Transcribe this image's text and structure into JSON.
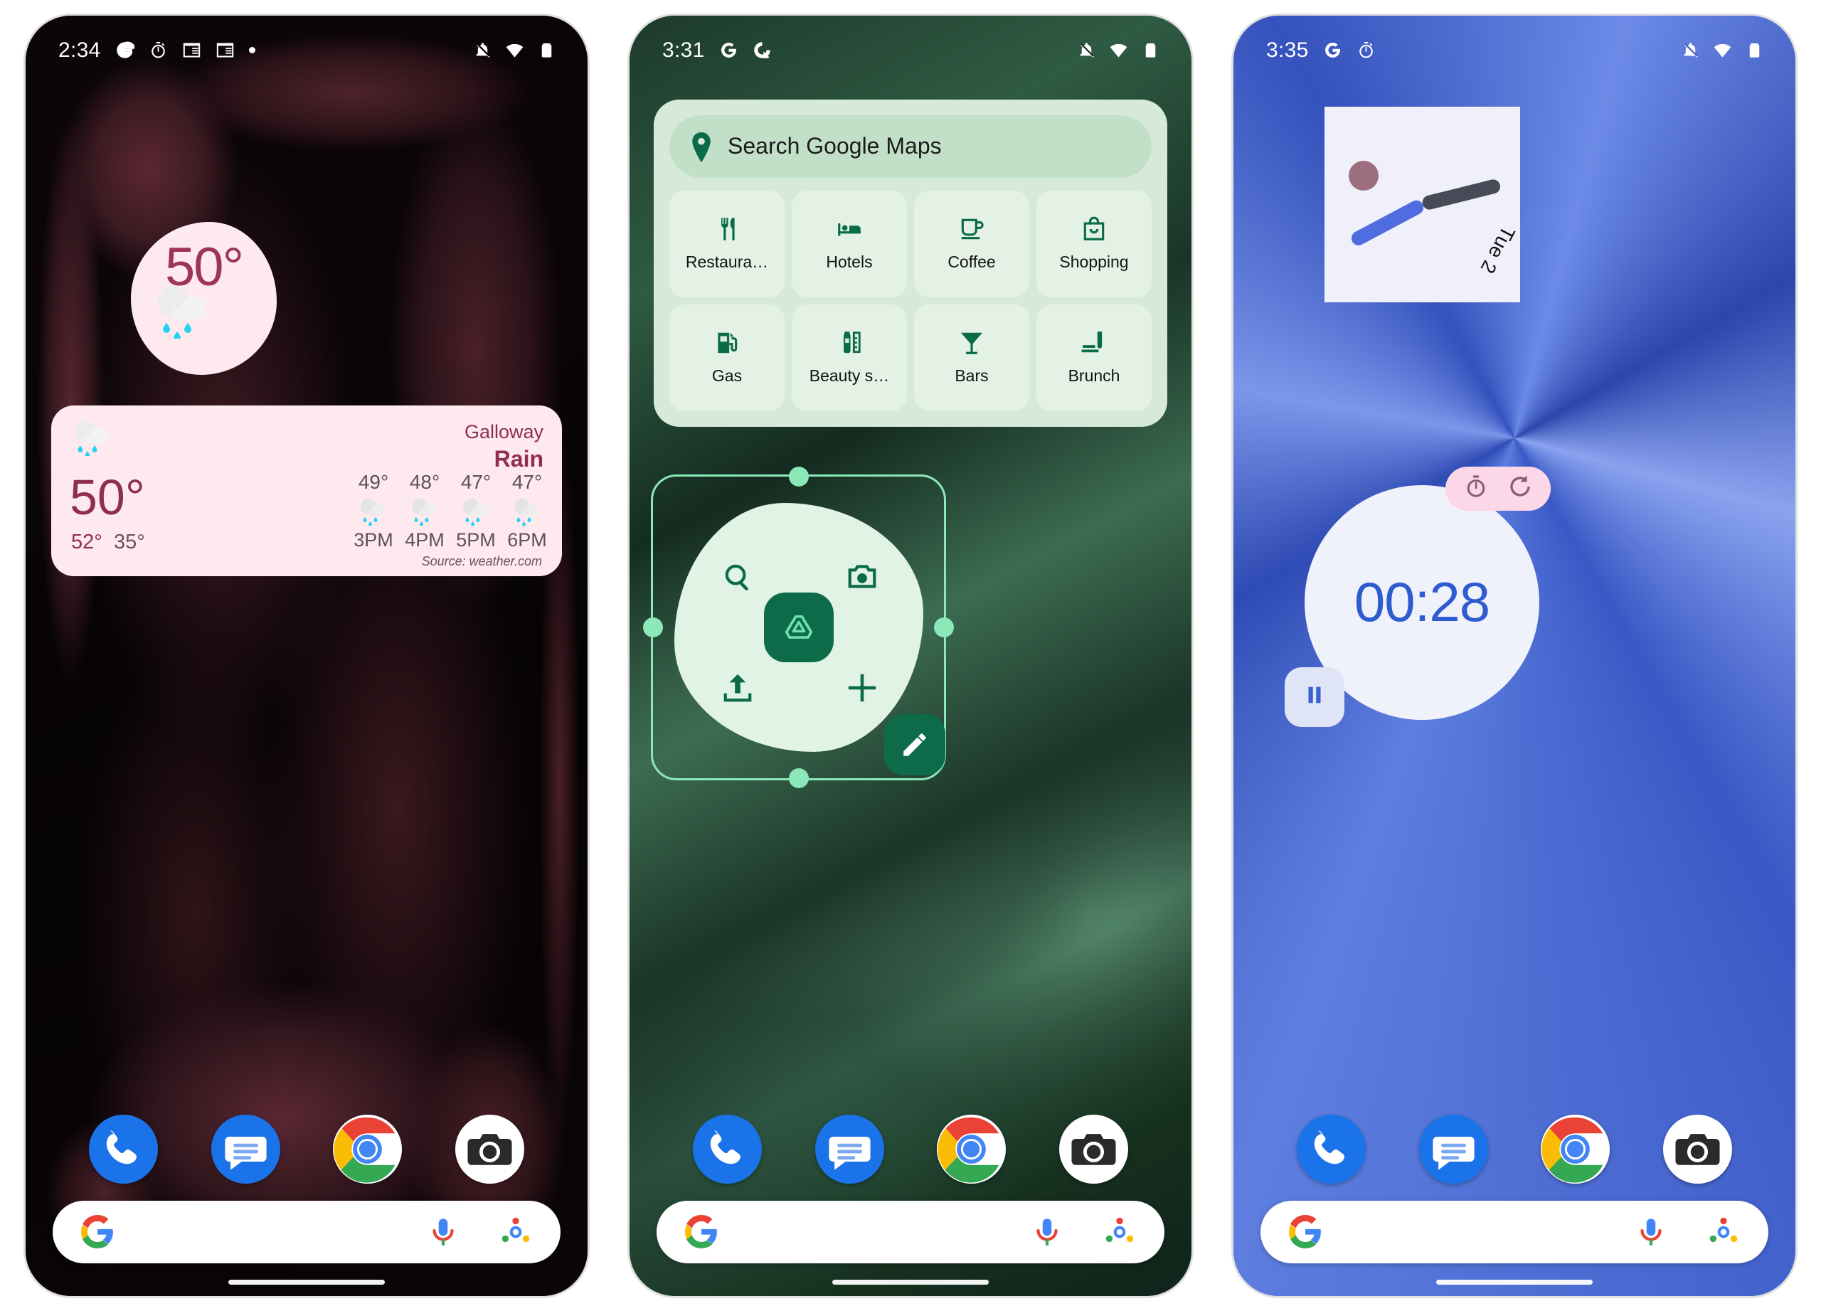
{
  "phones": [
    {
      "id": "phone-weather",
      "status": {
        "time": "2:34",
        "icons": [
          "google-g-icon",
          "timer-icon",
          "calendar-icon",
          "calendar-icon",
          "dot-icon"
        ],
        "right_icons": [
          "notifications-off-icon",
          "wifi-icon",
          "battery-icon"
        ]
      },
      "weather_bubble": {
        "temperature": "50°",
        "icon": "rain-cloud-icon"
      },
      "weather_card": {
        "location": "Galloway",
        "condition": "Rain",
        "temperature": "50°",
        "high": "52°",
        "low": "35°",
        "source": "Source: weather.com",
        "hourly": [
          {
            "temp": "49°",
            "label": "3PM",
            "icon": "rain-cloud-icon"
          },
          {
            "temp": "48°",
            "label": "4PM",
            "icon": "rain-cloud-icon"
          },
          {
            "temp": "47°",
            "label": "5PM",
            "icon": "rain-cloud-icon"
          },
          {
            "temp": "47°",
            "label": "6PM",
            "icon": "rain-cloud-icon"
          }
        ]
      },
      "dock": [
        "phone-app-icon",
        "messages-app-icon",
        "chrome-app-icon",
        "camera-app-icon"
      ],
      "search": {
        "left_icon": "google-g-icon",
        "mic_icon": "microphone-icon",
        "lens_icon": "google-lens-icon"
      }
    },
    {
      "id": "phone-maps",
      "status": {
        "time": "3:31",
        "icons": [
          "google-g-icon",
          "sync-icon"
        ],
        "right_icons": [
          "notifications-off-icon",
          "wifi-icon",
          "battery-icon"
        ]
      },
      "maps_widget": {
        "search_placeholder": "Search Google Maps",
        "pin_icon": "map-pin-icon",
        "categories": [
          {
            "label": "Restaura…",
            "icon": "restaurant-icon"
          },
          {
            "label": "Hotels",
            "icon": "hotel-bed-icon"
          },
          {
            "label": "Coffee",
            "icon": "coffee-cup-icon"
          },
          {
            "label": "Shopping",
            "icon": "shopping-bag-icon"
          },
          {
            "label": "Gas",
            "icon": "gas-pump-icon"
          },
          {
            "label": "Beauty s…",
            "icon": "nail-polish-icon"
          },
          {
            "label": "Bars",
            "icon": "cocktail-glass-icon"
          },
          {
            "label": "Brunch",
            "icon": "brunch-icon"
          }
        ]
      },
      "drive_widget": {
        "state": "selected-resizing",
        "icons": [
          "search-icon",
          "camera-icon",
          "drive-logo-icon",
          "upload-icon",
          "plus-icon"
        ],
        "fab_icon": "pencil-edit-icon",
        "handles": [
          "resize-handle-top",
          "resize-handle-bottom",
          "resize-handle-left",
          "resize-handle-right"
        ]
      },
      "dock": [
        "phone-app-icon",
        "messages-app-icon",
        "chrome-app-icon",
        "camera-app-icon"
      ],
      "search": {
        "left_icon": "google-g-icon",
        "mic_icon": "microphone-icon",
        "lens_icon": "google-lens-icon"
      }
    },
    {
      "id": "phone-clock",
      "status": {
        "time": "3:35",
        "icons": [
          "google-g-icon",
          "timer-icon"
        ],
        "right_icons": [
          "notifications-off-icon",
          "wifi-icon",
          "battery-icon"
        ]
      },
      "clock_widget": {
        "day_label": "Tue 2",
        "hour_hand_icon": "clock-hour-hand",
        "minute_hand_icon": "clock-minute-hand"
      },
      "timer_widget": {
        "time": "00:28",
        "timer_icon": "stopwatch-icon",
        "reset_icon": "reset-icon",
        "pause_icon": "pause-icon"
      },
      "dock": [
        "phone-app-icon",
        "messages-app-icon",
        "chrome-app-icon",
        "camera-app-icon"
      ],
      "search": {
        "left_icon": "google-g-icon",
        "mic_icon": "microphone-icon",
        "lens_icon": "google-lens-icon"
      }
    }
  ],
  "colors": {
    "weather_pink": "#fde9ee",
    "weather_accent": "#8f2f50",
    "maps_green": "#d7ead9",
    "maps_cell": "#e3f2e5",
    "drive_green": "#0d6b4a",
    "select_mint": "#8ce8b8",
    "clock_face": "#eff0fa",
    "timer_blue": "#2f5bd0",
    "timer_pill_pink": "#fbd7e7",
    "rain_drop": "#24d2f5"
  }
}
